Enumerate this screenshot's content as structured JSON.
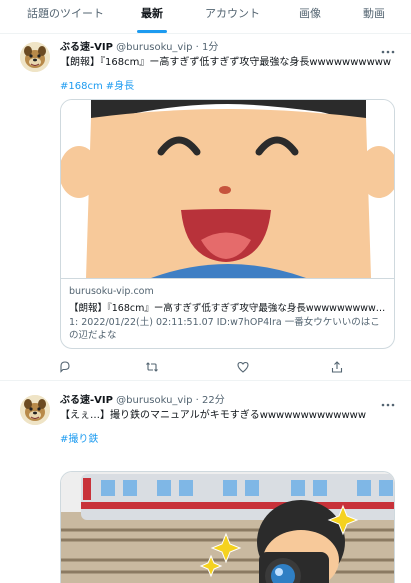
{
  "tabs": [
    {
      "label": "話題のツイート"
    },
    {
      "label": "最新"
    },
    {
      "label": "アカウント"
    },
    {
      "label": "画像"
    },
    {
      "label": "動画"
    }
  ],
  "active_tab": "最新",
  "accent_color": "#1d9bf0",
  "tweets": [
    {
      "user_name": "ぶる速-VIP",
      "handle": "@burusoku_vip",
      "time": "· 1分",
      "text": "【朗報】『168cm』ー高すぎず低すぎず攻守最強な身長wwwwwwwwww",
      "hashtags": [
        "#168cm",
        "#身長"
      ],
      "card": {
        "domain": "burusoku-vip.com",
        "title": "【朗報】『168cm』ー高すぎず低すぎず攻守最強な身長wwwwwwwwwwwww",
        "description": "1: 2022/01/22(土) 02:11:51.07 ID:w7hOP4Ira 一番女ウケいいのはこの辺だよな"
      },
      "actions": [
        "reply-icon",
        "retweet-icon",
        "like-icon",
        "share-icon"
      ]
    },
    {
      "user_name": "ぶる速-VIP",
      "handle": "@burusoku_vip",
      "time": "· 22分",
      "text": "【えぇ…】撮り鉄のマニュアルがキモすぎるwwwwwwwwwwwww",
      "hashtags": [
        "#撮り鉄"
      ]
    }
  ]
}
